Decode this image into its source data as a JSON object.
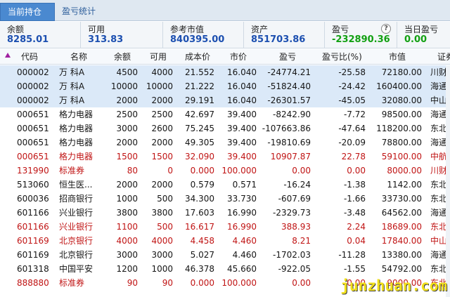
{
  "tabs": [
    {
      "label": "当前持仓"
    },
    {
      "label": "盈亏统计"
    }
  ],
  "summary": {
    "balance_label": "余额",
    "balance_value": "8285.01",
    "available_label": "可用",
    "available_value": "313.83",
    "market_value_label": "参考市值",
    "market_value_value": "840395.00",
    "assets_label": "资产",
    "assets_value": "851703.86",
    "pnl_label": "盈亏",
    "pnl_value": "-232890.36",
    "help_glyph": "?",
    "today_pnl_label": "当日盈亏",
    "today_pnl_value": "0.00"
  },
  "table": {
    "headers": {
      "code": "代码",
      "name": "名称",
      "balance": "余额",
      "available": "可用",
      "cost": "成本价",
      "price": "市价",
      "pnl": "盈亏",
      "pnl_ratio": "盈亏比(%)",
      "market_value": "市值",
      "broker": "证券"
    },
    "rows": [
      {
        "code": "000002",
        "name": "万 科A",
        "balance": "4500",
        "available": "4000",
        "cost": "21.552",
        "price": "16.040",
        "pnl": "-24774.21",
        "pnl_ratio": "-25.58",
        "market_value": "72180.00",
        "broker": "川财"
      },
      {
        "code": "000002",
        "name": "万 科A",
        "balance": "10000",
        "available": "10000",
        "cost": "21.222",
        "price": "16.040",
        "pnl": "-51824.40",
        "pnl_ratio": "-24.42",
        "market_value": "160400.00",
        "broker": "海通"
      },
      {
        "code": "000002",
        "name": "万 科A",
        "balance": "2000",
        "available": "2000",
        "cost": "29.191",
        "price": "16.040",
        "pnl": "-26301.57",
        "pnl_ratio": "-45.05",
        "market_value": "32080.00",
        "broker": "中山"
      },
      {
        "code": "000651",
        "name": "格力电器",
        "balance": "2500",
        "available": "2500",
        "cost": "42.697",
        "price": "39.400",
        "pnl": "-8242.90",
        "pnl_ratio": "-7.72",
        "market_value": "98500.00",
        "broker": "海通"
      },
      {
        "code": "000651",
        "name": "格力电器",
        "balance": "3000",
        "available": "2600",
        "cost": "75.245",
        "price": "39.400",
        "pnl": "-107663.86",
        "pnl_ratio": "-47.64",
        "market_value": "118200.00",
        "broker": "东北"
      },
      {
        "code": "000651",
        "name": "格力电器",
        "balance": "2000",
        "available": "2000",
        "cost": "49.305",
        "price": "39.400",
        "pnl": "-19810.69",
        "pnl_ratio": "-20.09",
        "market_value": "78800.00",
        "broker": "海通"
      },
      {
        "code": "000651",
        "name": "格力电器",
        "balance": "1500",
        "available": "1500",
        "cost": "32.090",
        "price": "39.400",
        "pnl": "10907.87",
        "pnl_ratio": "22.78",
        "market_value": "59100.00",
        "broker": "中航"
      },
      {
        "code": "131990",
        "name": "标准券",
        "balance": "80",
        "available": "0",
        "cost": "0.000",
        "price": "100.000",
        "pnl": "0.00",
        "pnl_ratio": "0.00",
        "market_value": "8000.00",
        "broker": "川财"
      },
      {
        "code": "513060",
        "name": "恒生医...",
        "balance": "2000",
        "available": "2000",
        "cost": "0.579",
        "price": "0.571",
        "pnl": "-16.24",
        "pnl_ratio": "-1.38",
        "market_value": "1142.00",
        "broker": "东北"
      },
      {
        "code": "600036",
        "name": "招商银行",
        "balance": "1000",
        "available": "500",
        "cost": "34.300",
        "price": "33.730",
        "pnl": "-607.69",
        "pnl_ratio": "-1.66",
        "market_value": "33730.00",
        "broker": "东北"
      },
      {
        "code": "601166",
        "name": "兴业银行",
        "balance": "3800",
        "available": "3800",
        "cost": "17.603",
        "price": "16.990",
        "pnl": "-2329.73",
        "pnl_ratio": "-3.48",
        "market_value": "64562.00",
        "broker": "海通"
      },
      {
        "code": "601166",
        "name": "兴业银行",
        "balance": "1100",
        "available": "500",
        "cost": "16.617",
        "price": "16.990",
        "pnl": "388.93",
        "pnl_ratio": "2.24",
        "market_value": "18689.00",
        "broker": "东北"
      },
      {
        "code": "601169",
        "name": "北京银行",
        "balance": "4000",
        "available": "4000",
        "cost": "4.458",
        "price": "4.460",
        "pnl": "8.21",
        "pnl_ratio": "0.04",
        "market_value": "17840.00",
        "broker": "中山"
      },
      {
        "code": "601169",
        "name": "北京银行",
        "balance": "3000",
        "available": "3000",
        "cost": "5.027",
        "price": "4.460",
        "pnl": "-1702.03",
        "pnl_ratio": "-11.28",
        "market_value": "13380.00",
        "broker": "海通"
      },
      {
        "code": "601318",
        "name": "中国平安",
        "balance": "1200",
        "available": "1000",
        "cost": "46.378",
        "price": "45.660",
        "pnl": "-922.05",
        "pnl_ratio": "-1.55",
        "market_value": "54792.00",
        "broker": "东北"
      },
      {
        "code": "888880",
        "name": "标准券",
        "balance": "90",
        "available": "90",
        "cost": "0.000",
        "price": "100.000",
        "pnl": "0.00",
        "pnl_ratio": "0.00",
        "market_value": "9000.00",
        "broker": "东北"
      }
    ]
  },
  "watermark": "junzhuan.com",
  "colors": {
    "positive": "#c01414",
    "negative": "#151515",
    "value_blue": "#1c4fb0",
    "value_green": "#12a012",
    "tab_active": "#4a89d0"
  }
}
